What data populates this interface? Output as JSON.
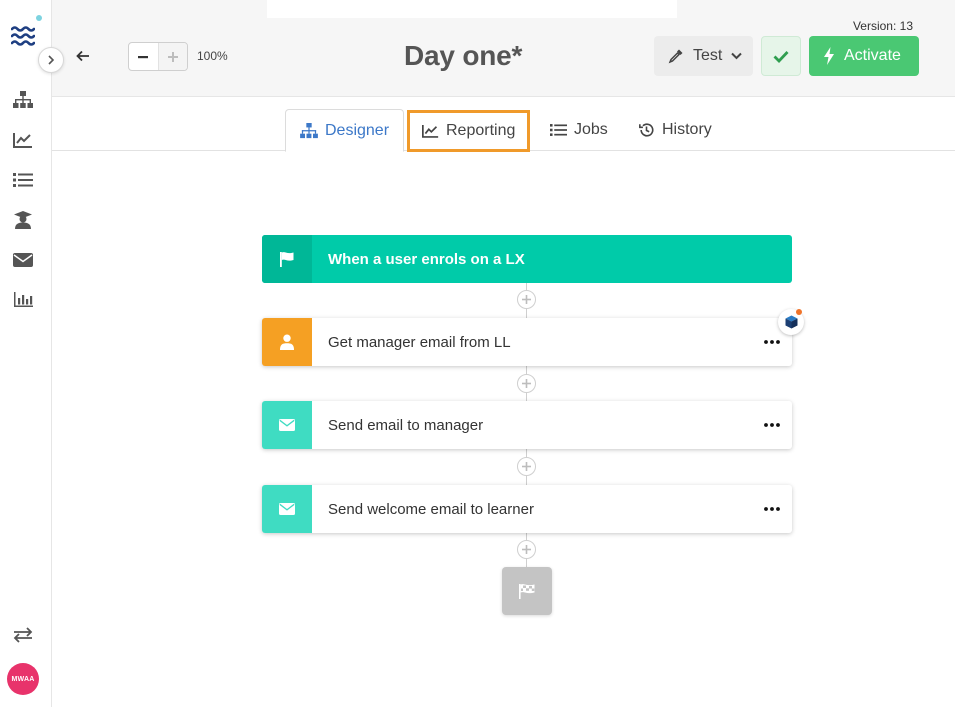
{
  "sidebar": {
    "nav": [
      {
        "name": "workflows",
        "icon": "sitemap-icon"
      },
      {
        "name": "analytics",
        "icon": "chart-line-icon"
      },
      {
        "name": "lists",
        "icon": "list-icon"
      },
      {
        "name": "learners",
        "icon": "graduate-icon"
      },
      {
        "name": "messages",
        "icon": "envelope-icon"
      },
      {
        "name": "reports",
        "icon": "bar-chart-icon"
      }
    ],
    "switch_icon": "exchange-icon",
    "avatar_initials": "MWAA",
    "avatar_color": "#e8336b"
  },
  "header": {
    "zoom_level": "100%",
    "title": "Day one*",
    "version": "Version: 13",
    "test_label": "Test",
    "activate_label": "Activate"
  },
  "tabs": [
    {
      "label": "Designer",
      "icon": "sitemap-icon",
      "active": true
    },
    {
      "label": "Reporting",
      "icon": "chart-line-icon",
      "highlighted": true
    },
    {
      "label": "Jobs",
      "icon": "list-icon"
    },
    {
      "label": "History",
      "icon": "history-icon"
    }
  ],
  "workflow": {
    "trigger": {
      "label": "When a user enrols on a LX",
      "icon": "flag-icon",
      "color": "#00cba9"
    },
    "steps": [
      {
        "label": "Get manager email from LL",
        "icon": "user-icon",
        "color": "#f5a023"
      },
      {
        "label": "Send email to manager",
        "icon": "envelope-icon",
        "color": "#3fdcc2"
      },
      {
        "label": "Send welcome email to learner",
        "icon": "envelope-icon",
        "color": "#3fdcc2"
      }
    ],
    "end_icon": "checkered-flag-icon"
  },
  "colors": {
    "accent_blue": "#3c78c8",
    "activate_green": "#4ac873",
    "highlight_orange": "#f09a2a"
  }
}
